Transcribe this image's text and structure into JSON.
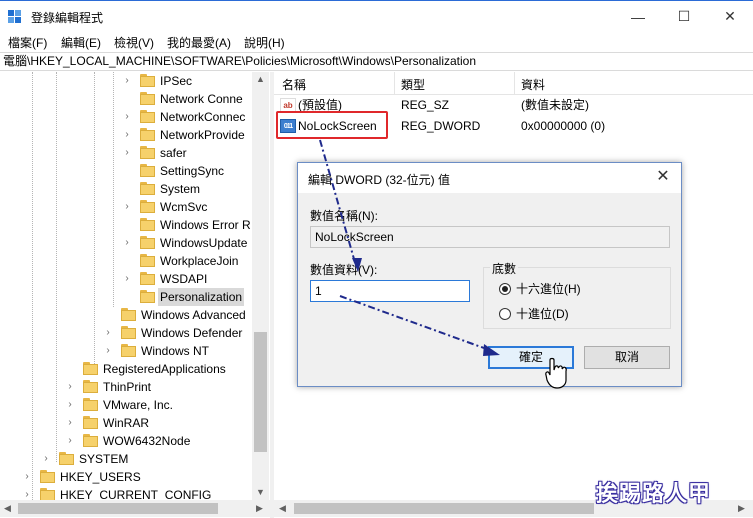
{
  "window": {
    "title": "登錄編輯程式",
    "minimize_glyph": "—",
    "maximize_glyph": "☐",
    "close_glyph": "✕"
  },
  "menu": [
    "檔案(F)",
    "編輯(E)",
    "檢視(V)",
    "我的最愛(A)",
    "說明(H)"
  ],
  "address": "電腦\\HKEY_LOCAL_MACHINE\\SOFTWARE\\Policies\\Microsoft\\Windows\\Personalization",
  "tree": {
    "items": [
      {
        "label": "IPSec",
        "expand": "›"
      },
      {
        "label": "Network Conne",
        "expand": ""
      },
      {
        "label": "NetworkConnec",
        "expand": "›"
      },
      {
        "label": "NetworkProvide",
        "expand": "›"
      },
      {
        "label": "safer",
        "expand": "›"
      },
      {
        "label": "SettingSync",
        "expand": ""
      },
      {
        "label": "System",
        "expand": ""
      },
      {
        "label": "WcmSvc",
        "expand": "›"
      },
      {
        "label": "Windows Error R",
        "expand": ""
      },
      {
        "label": "WindowsUpdate",
        "expand": "›"
      },
      {
        "label": "WorkplaceJoin",
        "expand": ""
      },
      {
        "label": "WSDAPI",
        "expand": "›"
      },
      {
        "label": "Personalization",
        "expand": ""
      },
      {
        "label": "Windows Advanced",
        "expand": ""
      },
      {
        "label": "Windows Defender",
        "expand": "›"
      },
      {
        "label": "Windows NT",
        "expand": "›"
      },
      {
        "label": "RegisteredApplications",
        "expand": ""
      },
      {
        "label": "ThinPrint",
        "expand": "›"
      },
      {
        "label": "VMware, Inc.",
        "expand": "›"
      },
      {
        "label": "WinRAR",
        "expand": "›"
      },
      {
        "label": "WOW6432Node",
        "expand": "›"
      },
      {
        "label": "SYSTEM",
        "expand": "›"
      },
      {
        "label": "HKEY_USERS",
        "expand": "›"
      },
      {
        "label": "HKEY_CURRENT_CONFIG",
        "expand": "›"
      }
    ]
  },
  "list": {
    "headers": [
      "名稱",
      "類型",
      "資料"
    ],
    "rows": [
      {
        "icon": "ab",
        "name": "(預設值)",
        "type": "REG_SZ",
        "data": "(數值未設定)"
      },
      {
        "icon": "011",
        "name": "NoLockScreen",
        "type": "REG_DWORD",
        "data": "0x00000000 (0)"
      }
    ]
  },
  "dialog": {
    "title": "編輯 DWORD (32-位元) 值",
    "close_glyph": "✕",
    "name_label": "數值名稱(N):",
    "name_value": "NoLockScreen",
    "data_label": "數值資料(V):",
    "data_value": "1",
    "base_label": "底數",
    "radio_hex": "十六進位(H)",
    "radio_dec": "十進位(D)",
    "ok": "確定",
    "cancel": "取消"
  },
  "watermark": "挨踢路人甲",
  "colors": {
    "accent": "#2b79d8",
    "highlight_box": "#e0282b",
    "annotation_arrow": "#1f2a8c"
  }
}
